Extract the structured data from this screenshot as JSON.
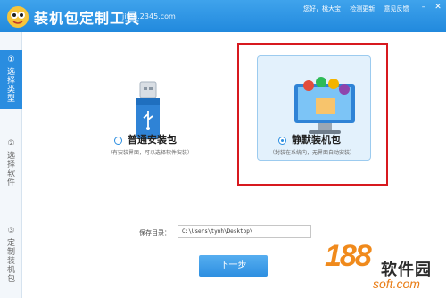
{
  "window": {
    "title": "装机包定制工具",
    "domain": "jifen.2345.com",
    "greeting": "您好，桃大宝",
    "check_update": "检测更新",
    "feedback": "意见反馈",
    "minimize_icon": "minimize-icon",
    "close_icon": "close-icon"
  },
  "sidebar": {
    "steps": [
      {
        "num": "①",
        "label": "选择类型",
        "active": true
      },
      {
        "num": "②",
        "label": "选择软件",
        "active": false
      },
      {
        "num": "③",
        "label": "定制装机包",
        "active": false
      }
    ]
  },
  "options": {
    "normal": {
      "label": "普通安装包",
      "desc": "（有安装界面，可以选择软件安装）",
      "selected": false
    },
    "silent": {
      "label": "静默装机包",
      "desc": "（封装在系统内，无界面自动安装）",
      "selected": true
    }
  },
  "save": {
    "label": "保存目录：",
    "path": "C:\\Users\\tynh\\Desktop\\"
  },
  "next_button": "下一步",
  "watermark": {
    "number": "188",
    "text": "软件园",
    "url": "soft.com"
  },
  "colors": {
    "accent": "#2a8de0",
    "highlight": "#d7191f",
    "watermark": "#f08a1c"
  }
}
